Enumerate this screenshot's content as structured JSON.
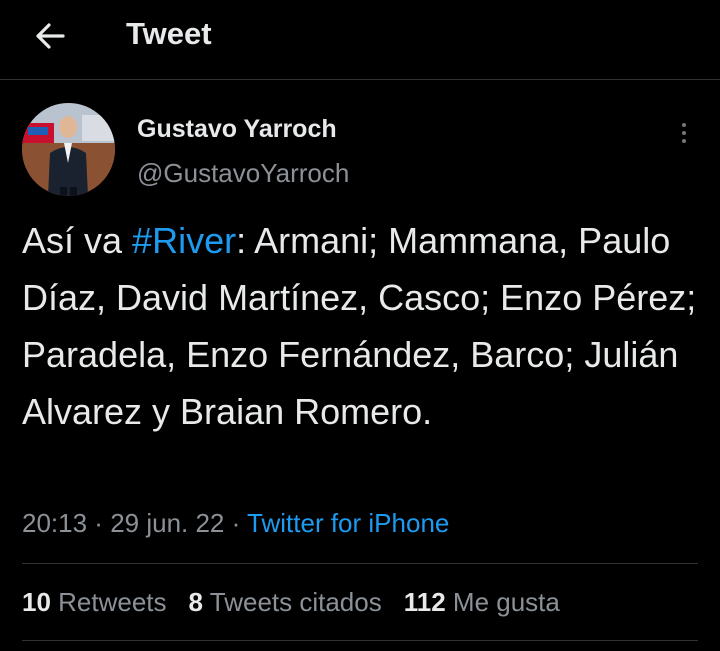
{
  "header": {
    "title": "Tweet",
    "back_icon": "arrow-left-icon"
  },
  "author": {
    "name": "Gustavo Yarroch",
    "handle": "@GustavoYarroch"
  },
  "tweet": {
    "text_before": "Así va ",
    "hashtag": "#River",
    "text_after": ": Armani; Mammana, Paulo Díaz, David Martínez, Casco; Enzo Pérez; Paradela, Enzo Fernández, Barco; Julián Alvarez y Braian Romero.",
    "time": "20:13",
    "date": "29 jun. 22",
    "separator": " · ",
    "source": "Twitter for iPhone"
  },
  "stats": {
    "retweets_count": "10",
    "retweets_label": " Retweets",
    "quotes_count": "8",
    "quotes_label": " Tweets citados",
    "likes_count": "112",
    "likes_label": " Me gusta"
  },
  "colors": {
    "background": "#000000",
    "text": "#e7e9ea",
    "secondary": "#8b9197",
    "accent": "#1d9bf0",
    "divider": "#2f3336"
  }
}
